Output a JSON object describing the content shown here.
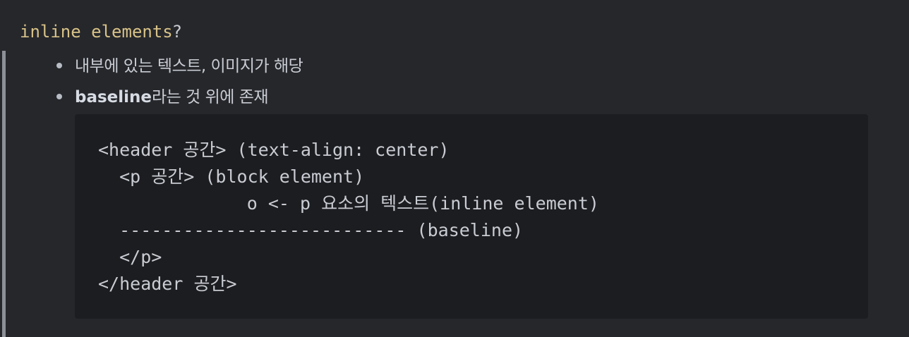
{
  "heading": {
    "code": "inline elements",
    "suffix": "?"
  },
  "bullets": [
    {
      "text": "내부에 있는 텍스트, 이미지가 해당"
    },
    {
      "bold": "baseline",
      "text": "라는 것 위에 존재"
    }
  ],
  "code_block": {
    "lines": [
      "<header 공간> (text-align: center)",
      "  <p 공간> (block element)",
      "              o <- p 요소의 텍스트(inline element)",
      "  --------------------------- (baseline)",
      "  </p>",
      "</header 공간>"
    ]
  }
}
